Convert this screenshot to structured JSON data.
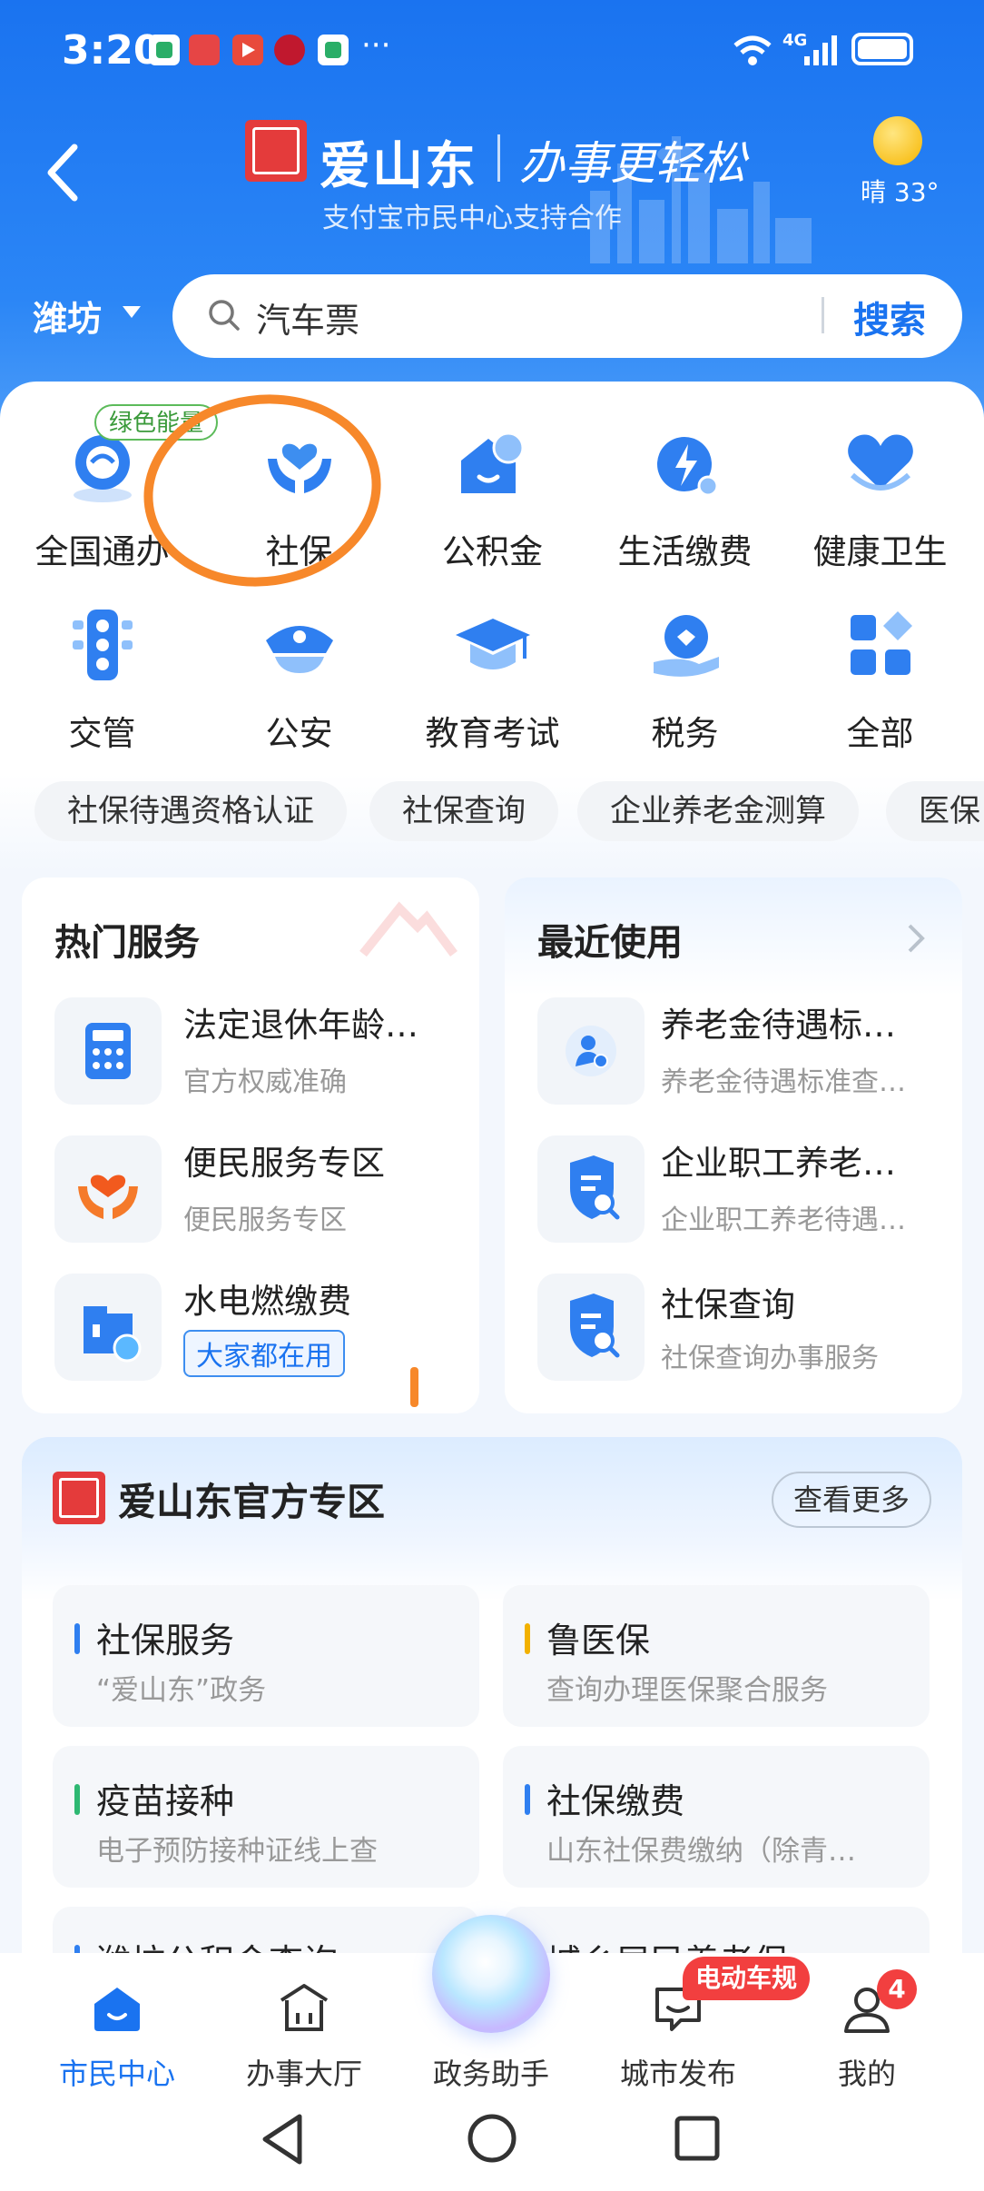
{
  "status_bar": {
    "time": "3:20",
    "network": "4G",
    "app_icons": [
      "wechat-icon",
      "toutiao-icon",
      "video-icon",
      "unionpay-icon",
      "wechat-icon"
    ],
    "more": "···"
  },
  "header": {
    "brand": "爱山东",
    "slogan": "办事更轻松",
    "subtitle": "支付宝市民中心支持合作",
    "weather": "晴 33°",
    "city": "潍坊",
    "search_value": "汽车票",
    "search_button": "搜索"
  },
  "services": [
    {
      "label": "全国通办",
      "icon": "globe-icon",
      "tag": "绿色能量"
    },
    {
      "label": "社保",
      "icon": "hands-heart-icon"
    },
    {
      "label": "公积金",
      "icon": "house-coin-icon"
    },
    {
      "label": "生活缴费",
      "icon": "bolt-icon"
    },
    {
      "label": "健康卫生",
      "icon": "heart-icon"
    },
    {
      "label": "交管",
      "icon": "traffic-light-icon"
    },
    {
      "label": "公安",
      "icon": "police-cap-icon"
    },
    {
      "label": "教育考试",
      "icon": "graduation-cap-icon"
    },
    {
      "label": "税务",
      "icon": "tax-hand-icon"
    },
    {
      "label": "全部",
      "icon": "grid-icon"
    }
  ],
  "chips": [
    "社保待遇资格认证",
    "社保查询",
    "企业养老金测算",
    "医保"
  ],
  "hot": {
    "title": "热门服务",
    "items": [
      {
        "title": "法定退休年龄…",
        "sub": "官方权威准确",
        "icon": "calculator-icon"
      },
      {
        "title": "便民服务专区",
        "sub": "便民服务专区",
        "icon": "hands-heart-icon"
      },
      {
        "title": "水电燃缴费",
        "tag": "大家都在用",
        "icon": "utility-icon"
      }
    ]
  },
  "recent": {
    "title": "最近使用",
    "items": [
      {
        "title": "养老金待遇标…",
        "sub": "养老金待遇标准查…",
        "icon": "elder-icon"
      },
      {
        "title": "企业职工养老…",
        "sub": "企业职工养老待遇…",
        "icon": "shield-search-icon"
      },
      {
        "title": "社保查询",
        "sub": "社保查询办事服务",
        "icon": "shield-search-icon"
      }
    ]
  },
  "official": {
    "title": "爱山东官方专区",
    "more": "查看更多",
    "tiles": [
      {
        "title": "社保服务",
        "sub": "“爱山东”政务",
        "color": "#2f7ff0"
      },
      {
        "title": "鲁医保",
        "sub": "查询办理医保聚合服务",
        "color": "#f2b100"
      },
      {
        "title": "疫苗接种",
        "sub": "电子预防接种证线上查",
        "color": "#2eb872"
      },
      {
        "title": "社保缴费",
        "sub": "山东社保费缴纳（除青…",
        "color": "#2f7ff0"
      },
      {
        "title": "潍坊公积金查询",
        "sub": "",
        "color": "#2f7ff0"
      },
      {
        "title": "城乡居民养老保",
        "sub": "",
        "color": "#f2b100"
      }
    ]
  },
  "tabs": [
    {
      "label": "市民中心",
      "icon": "home-icon",
      "active": true
    },
    {
      "label": "办事大厅",
      "icon": "hall-icon"
    },
    {
      "label": "政务助手",
      "icon": "assistant-orb-icon"
    },
    {
      "label": "城市发布",
      "icon": "chat-icon",
      "badge": "电动车规"
    },
    {
      "label": "我的",
      "icon": "user-icon",
      "badge": "4"
    }
  ],
  "colors": {
    "primary": "#1a73f0",
    "annotation": "#f7882a",
    "badge": "#f23f3f"
  }
}
